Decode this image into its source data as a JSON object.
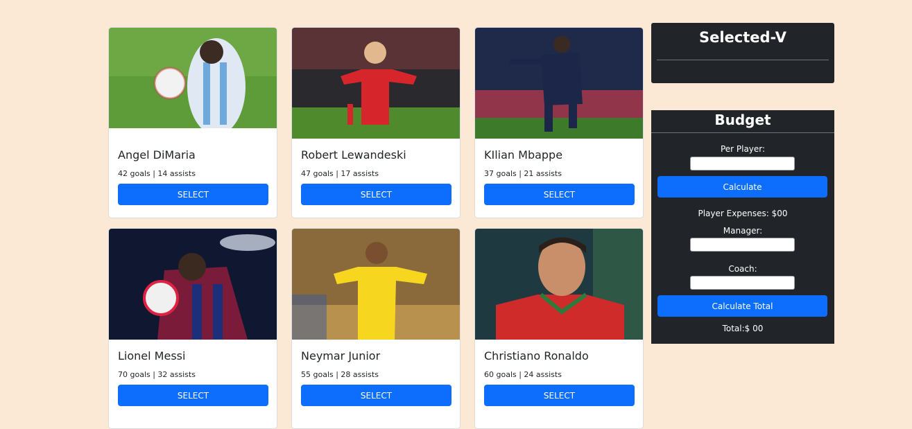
{
  "players": [
    {
      "name": "Angel DiMaria",
      "stats": "42 goals | 14 assists",
      "button": "SELECT"
    },
    {
      "name": "Robert Lewandeski",
      "stats": "47 goals | 17 assists",
      "button": "SELECT"
    },
    {
      "name": "KIlian Mbappe",
      "stats": "37 goals | 21 assists",
      "button": "SELECT"
    },
    {
      "name": "Lionel Messi",
      "stats": "70 goals | 32 assists",
      "button": "SELECT"
    },
    {
      "name": "Neymar Junior",
      "stats": "55 goals | 28 assists",
      "button": "SELECT"
    },
    {
      "name": "Christiano Ronaldo",
      "stats": "60 goals | 24 assists",
      "button": "SELECT"
    }
  ],
  "selected_panel": {
    "title": "Selected-V"
  },
  "budget": {
    "title": "Budget",
    "per_player_label": "Per Player:",
    "calculate_label": "Calculate",
    "player_expenses": "Player Expenses: $00",
    "manager_label": "Manager:",
    "coach_label": "Coach:",
    "calculate_total_label": "Calculate Total",
    "total": "Total:$ 00"
  },
  "colors": {
    "background": "#fbe9d6",
    "primary": "#0d6efd",
    "panel": "#212529"
  }
}
